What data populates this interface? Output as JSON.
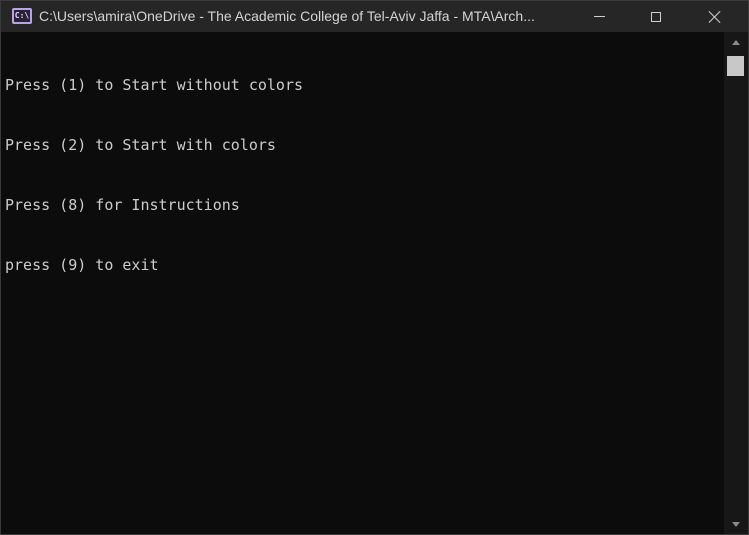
{
  "window": {
    "title": "C:\\Users\\amira\\OneDrive - The Academic College of Tel-Aviv Jaffa - MTA\\Arch...",
    "icon": "console-app-icon",
    "icon_text": "C:\\",
    "controls": [
      "minimize",
      "maximize",
      "close"
    ]
  },
  "console": {
    "lines": [
      "Press (1) to Start without colors",
      "Press (2) to Start with colors",
      "Press (8) for Instructions",
      "press (9) to exit"
    ]
  },
  "colors": {
    "console_background": "#0c0c0c",
    "console_text": "#cccccc",
    "titlebar_background": "#262626",
    "icon_accent": "#b9a2e8"
  }
}
